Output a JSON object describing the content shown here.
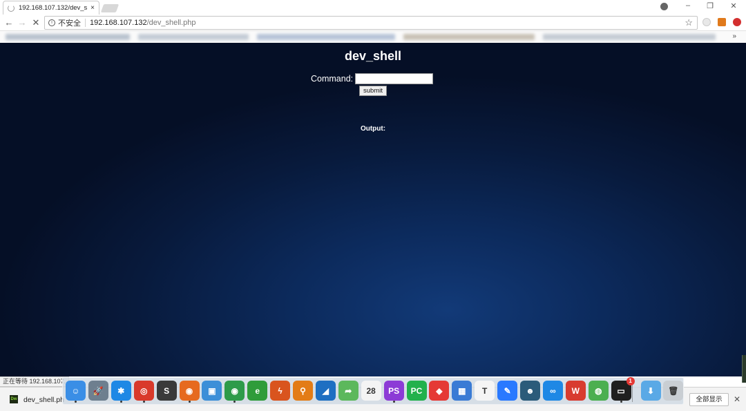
{
  "tab": {
    "title": "192.168.107.132/dev_s",
    "close": "×"
  },
  "window_controls": {
    "minimize": "–",
    "restore": "❐",
    "close": "✕"
  },
  "nav": {
    "back": "←",
    "forward": "→",
    "reload": "✕"
  },
  "address_bar": {
    "security_label": "不安全",
    "host": "192.168.107.132",
    "path": "/dev_shell.php",
    "bookmark_icon": "☆"
  },
  "bookmarks_bar": {
    "more": "»"
  },
  "page": {
    "title": "dev_shell",
    "command_label": "Command:",
    "command_value": "",
    "submit_label": "submit",
    "output_label": "Output:"
  },
  "status_bubble": "正在等待 192.168.107.",
  "download_shelf": {
    "file_icon_text": "Dw",
    "file_name": "dev_shell.ph",
    "show_all_label": "全部显示",
    "close": "✕"
  },
  "dock": {
    "items": [
      {
        "name": "finder-icon",
        "glyph": "☺",
        "color": "#3a8ee6"
      },
      {
        "name": "launchpad-icon",
        "glyph": "🚀",
        "color": "#6e7f8f"
      },
      {
        "name": "qq-icon",
        "glyph": "✱",
        "color": "#1e88e5"
      },
      {
        "name": "netease-music-icon",
        "glyph": "◎",
        "color": "#d93a2b"
      },
      {
        "name": "sublime-text-icon",
        "glyph": "S",
        "color": "#3a3a3a"
      },
      {
        "name": "firefox-icon",
        "glyph": "◉",
        "color": "#e66a1f"
      },
      {
        "name": "files-icon",
        "glyph": "▣",
        "color": "#3c8fd8"
      },
      {
        "name": "chrome-icon",
        "glyph": "◉",
        "color": "#2e9b4a"
      },
      {
        "name": "ie-icon",
        "glyph": "e",
        "color": "#2f9c3a"
      },
      {
        "name": "burp-icon",
        "glyph": "ϟ",
        "color": "#d9541e"
      },
      {
        "name": "search-tool-icon",
        "glyph": "⚲",
        "color": "#e37c16"
      },
      {
        "name": "wireshark-icon",
        "glyph": "◢",
        "color": "#1e6fc2"
      },
      {
        "name": "share-arrow-icon",
        "glyph": "➦",
        "color": "#5cb85c"
      },
      {
        "name": "calendar-icon",
        "glyph": "28",
        "color": "#f4f4f4"
      },
      {
        "name": "phpstorm-icon",
        "glyph": "PS",
        "color": "#8c3bd6"
      },
      {
        "name": "pycharm-icon",
        "glyph": "PC",
        "color": "#22b14c"
      },
      {
        "name": "colorful-app-icon",
        "glyph": "◆",
        "color": "#e53935"
      },
      {
        "name": "video-editor-icon",
        "glyph": "▦",
        "color": "#3a7bd5"
      },
      {
        "name": "typora-icon",
        "glyph": "T",
        "color": "#f5f5f5"
      },
      {
        "name": "editor-pen-icon",
        "glyph": "✎",
        "color": "#2979ff"
      },
      {
        "name": "mascot-app-icon",
        "glyph": "☻",
        "color": "#2b5b7a"
      },
      {
        "name": "baidu-netdisk-icon",
        "glyph": "∞",
        "color": "#1e88e5"
      },
      {
        "name": "wps-icon",
        "glyph": "W",
        "color": "#d83b2f"
      },
      {
        "name": "globe-app-icon",
        "glyph": "◍",
        "color": "#4caf50"
      },
      {
        "name": "terminal-icon",
        "glyph": "▭",
        "color": "#1f1f1f",
        "badge": "1"
      },
      {
        "name": "downloads-folder-icon",
        "glyph": "⬇",
        "color": "#5aa9e6"
      },
      {
        "name": "trash-icon",
        "glyph": "🗑",
        "color": "#c9ced3"
      }
    ]
  },
  "colors": {
    "page_bg_center": "#123a78",
    "page_bg_edge": "#050f26",
    "accent": "#ffffff"
  }
}
